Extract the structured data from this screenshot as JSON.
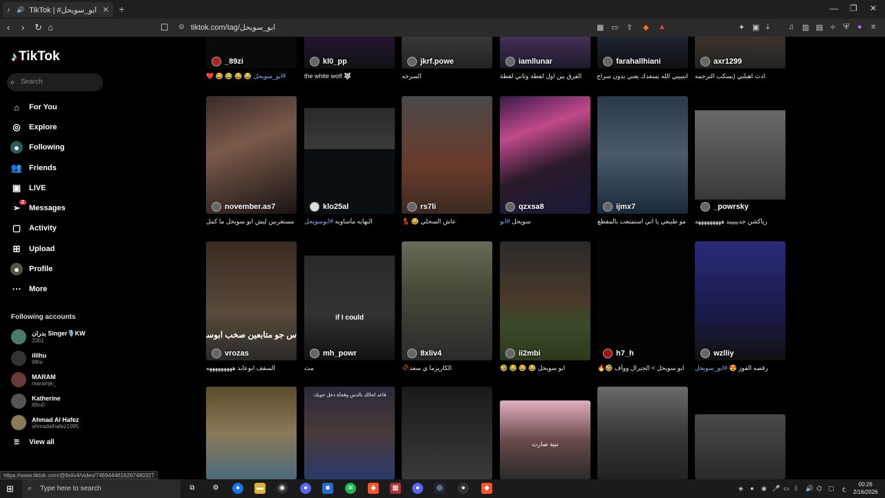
{
  "browser": {
    "tab_title": "TikTok | #ابو_سويحل",
    "new_tab": "+",
    "url": "tiktok.com/tag/ابو_سويحل",
    "status_url": "https://www.tiktok.com/@8xliv4/video/7469444816267480327"
  },
  "sidebar": {
    "logo": "TikTok",
    "search_placeholder": "Search",
    "nav": [
      {
        "label": "For You",
        "icon": "home-icon"
      },
      {
        "label": "Explore",
        "icon": "compass-icon"
      },
      {
        "label": "Following",
        "icon": "following-icon"
      },
      {
        "label": "Friends",
        "icon": "friends-icon"
      },
      {
        "label": "LIVE",
        "icon": "live-icon"
      },
      {
        "label": "Messages",
        "icon": "messages-icon",
        "badge": "2"
      },
      {
        "label": "Activity",
        "icon": "activity-icon"
      },
      {
        "label": "Upload",
        "icon": "upload-icon"
      },
      {
        "label": "Profile",
        "icon": "profile-icon"
      },
      {
        "label": "More",
        "icon": "more-icon"
      }
    ],
    "following_title": "Following accounts",
    "accounts": [
      {
        "name": "بدران Singer🎙️KW",
        "handle": "33b1"
      },
      {
        "name": "illlhu",
        "handle": "illlhu"
      },
      {
        "name": "MARAM",
        "handle": "maramjk_"
      },
      {
        "name": "Katherine",
        "handle": "illhu0"
      },
      {
        "name": "Ahmad Al Hafez",
        "handle": "ahmadalhafez1995"
      }
    ],
    "view_all": "View all"
  },
  "grid": {
    "row1": [
      {
        "user": "_89zi",
        "caption": "😂 😂 😂 😂 ❤️ ",
        "tag": "#ابو_سويحل"
      },
      {
        "user": "kl0_pp",
        "caption": "the white wolf 🐺",
        "tag": ""
      },
      {
        "user": "jkrf.powe",
        "caption": "السرخه",
        "tag": ""
      },
      {
        "user": "iamllunar",
        "caption": "الفرق بين اول لقطة وثاني لقطة",
        "tag": ""
      },
      {
        "user": "farahallhiani",
        "caption": "انتيييي الله يسعدك يعني بدون سراخ",
        "tag": ""
      },
      {
        "user": "axr1299",
        "caption": ".ادث اهبلني (بسكب الترجمه",
        "tag": ""
      }
    ],
    "row2": [
      {
        "user": "november.as7",
        "caption": "مستغربين ليش ابو سويحل ما كمل",
        "tag": ""
      },
      {
        "user": "klo25al",
        "caption": "النهايه مأساويه ",
        "tag": "#ابوسويحل"
      },
      {
        "user": "rs7li",
        "caption": "عاش السحلي 😂 💃",
        "tag": ""
      },
      {
        "user": "qzxsa8",
        "caption": "سويحل ",
        "tag": "#ابو"
      },
      {
        "user": "ijmx7",
        "caption": "مو طبيعي يا اني استمتعت بالمقطع",
        "tag": ""
      },
      {
        "user": "_powrsky",
        "caption": "رياكشن جديييييد هههههههههه",
        "tag": ""
      }
    ],
    "row3": [
      {
        "user": "vrozas",
        "caption": "السقف ابوعابد هههههههههه",
        "tag": ""
      },
      {
        "user": "mh_powr",
        "caption": "مت",
        "tag": ""
      },
      {
        "user": "8xliv4",
        "caption": "الكاريزما ي سعد🥀",
        "tag": ""
      },
      {
        "user": "ii2mbi",
        "caption": "ابو سويحل 😂 😂 😂 🤣",
        "tag": ""
      },
      {
        "user": "h7_h",
        "caption": "ابو سويحل > الجنرال ووأف 🤣🔥",
        "tag": ""
      },
      {
        "user": "wzlliy",
        "caption": "رقصه الفوز 😍 ",
        "tag": "#ابو_سويحل"
      }
    ],
    "overlays": {
      "if_i_could": "if I could",
      "arabic_overlay": "س جو متابعين صخب ابوسويحل",
      "nibra": "نبية صارت",
      "top_text": "قاعد لحالك بالدس وفجأة دخل خويك:"
    }
  },
  "taskbar": {
    "search_placeholder": "Type here to search",
    "time": "00:26",
    "date": "2/16/2026",
    "lang": "ع"
  }
}
